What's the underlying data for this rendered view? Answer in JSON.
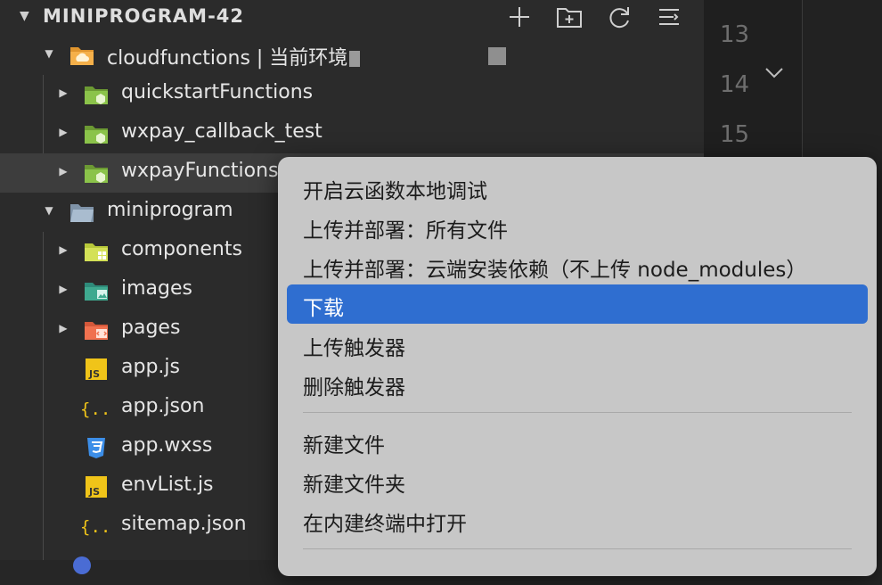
{
  "explorer": {
    "title": "MINIPROGRAM-42",
    "actions": [
      "new-file",
      "new-folder",
      "refresh",
      "collapse-all"
    ]
  },
  "tree": {
    "cloudfunctions": "cloudfunctions | 当前环境",
    "quickstartFunctions": "quickstartFunctions",
    "wxpay_callback_test": "wxpay_callback_test",
    "wxpayFunctions": "wxpayFunctions",
    "miniprogram": "miniprogram",
    "components": "components",
    "images": "images",
    "pages": "pages",
    "app_js": "app.js",
    "app_json": "app.json",
    "app_wxss": "app.wxss",
    "envList_js": "envList.js",
    "sitemap_json": "sitemap.json"
  },
  "editor": {
    "line_numbers": [
      "13",
      "14",
      "15"
    ]
  },
  "context_menu": {
    "items": [
      "开启云函数本地调试",
      "上传并部署：所有文件",
      "上传并部署：云端安装依赖（不上传 node_modules）",
      "下载",
      "上传触发器",
      "删除触发器",
      "新建文件",
      "新建文件夹",
      "在内建终端中打开"
    ],
    "active_index": 3
  },
  "colors": {
    "menu_bg": "#c7c7c7",
    "menu_highlight": "#2f6ed0",
    "cloud_folder": "#f5b04a",
    "cloud_function_folder": "#8bc34a",
    "js_icon": "#f0c419",
    "json_icon": "#f0c419",
    "css_icon": "#3c8ee8"
  }
}
